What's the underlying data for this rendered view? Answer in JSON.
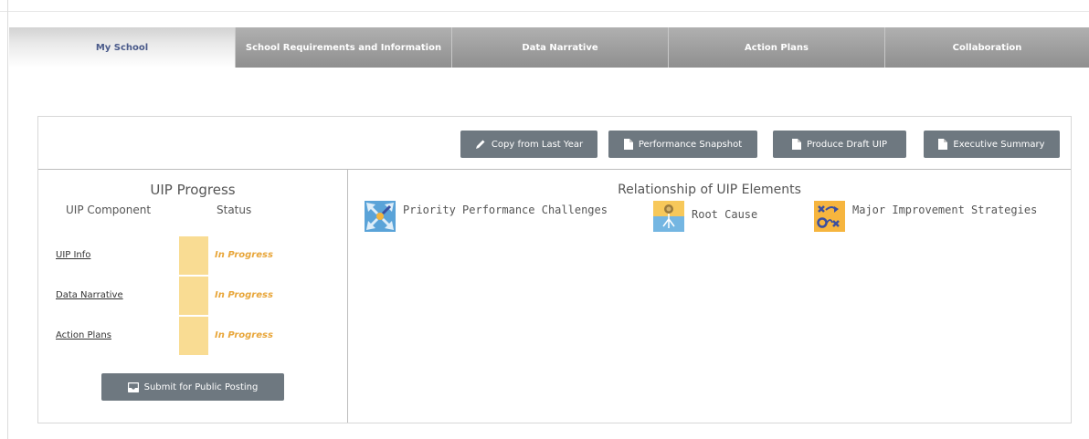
{
  "tabs": [
    {
      "label": "My School",
      "active": true
    },
    {
      "label": "School Requirements and Information",
      "active": false
    },
    {
      "label": "Data Narrative",
      "active": false
    },
    {
      "label": "Action Plans",
      "active": false
    },
    {
      "label": "Collaboration",
      "active": false
    }
  ],
  "toolbar": {
    "copy_label": "Copy from Last Year",
    "snapshot_label": "Performance Snapshot",
    "draft_label": "Produce Draft UIP",
    "summary_label": "Executive Summary"
  },
  "progress": {
    "title": "UIP Progress",
    "col_component": "UIP Component",
    "col_status": "Status",
    "rows": [
      {
        "component": "UIP Info",
        "status": "In Progress"
      },
      {
        "component": "Data Narrative",
        "status": "In Progress"
      },
      {
        "component": "Action Plans",
        "status": "In Progress"
      }
    ],
    "submit_label": "Submit for Public Posting"
  },
  "relationship": {
    "title": "Relationship of UIP Elements",
    "items": [
      {
        "label": "Priority Performance Challenges",
        "icon": "arrows-converge-icon"
      },
      {
        "label": "Root Cause",
        "icon": "root-plant-icon"
      },
      {
        "label": "Major Improvement Strategies",
        "icon": "strategy-play-icon"
      }
    ]
  },
  "colors": {
    "tab_active_text": "#4a5a8a",
    "button_bg": "#6e7880",
    "status_color": "#e8a63a",
    "status_bar": "#f9dc93"
  }
}
